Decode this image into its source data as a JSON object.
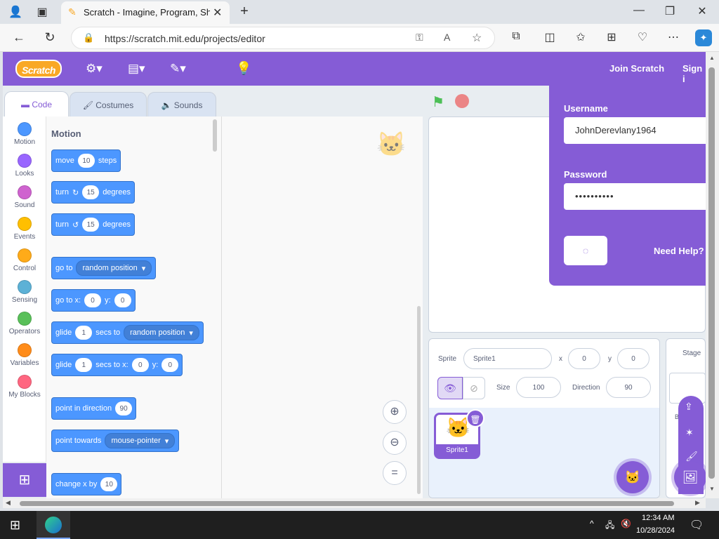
{
  "browser": {
    "tab_title": "Scratch - Imagine, Program, Share",
    "url": "https://scratch.mit.edu/projects/editor"
  },
  "menu": {
    "logo": "Scratch",
    "join": "Join Scratch",
    "signin": "Sign i"
  },
  "tabs": [
    "Code",
    "Costumes",
    "Sounds"
  ],
  "categories": [
    {
      "label": "Motion",
      "color": "#4c97ff"
    },
    {
      "label": "Looks",
      "color": "#9966ff"
    },
    {
      "label": "Sound",
      "color": "#cf63cf"
    },
    {
      "label": "Events",
      "color": "#ffbf00"
    },
    {
      "label": "Control",
      "color": "#ffab19"
    },
    {
      "label": "Sensing",
      "color": "#5cb1d6"
    },
    {
      "label": "Operators",
      "color": "#59c059"
    },
    {
      "label": "Variables",
      "color": "#ff8c1a"
    },
    {
      "label": "My Blocks",
      "color": "#ff6680"
    }
  ],
  "palette": {
    "title": "Motion",
    "b1": {
      "a": "move",
      "n": "10",
      "b": "steps"
    },
    "b2": {
      "a": "turn",
      "n": "15",
      "b": "degrees"
    },
    "b3": {
      "a": "turn",
      "n": "15",
      "b": "degrees"
    },
    "b4": {
      "a": "go to",
      "d": "random position"
    },
    "b5": {
      "a": "go to x:",
      "x": "0",
      "yl": "y:",
      "y": "0"
    },
    "b6": {
      "a": "glide",
      "n": "1",
      "b": "secs to",
      "d": "random position"
    },
    "b7": {
      "a": "glide",
      "n": "1",
      "b": "secs to x:",
      "x": "0",
      "yl": "y:",
      "y": "0"
    },
    "b8": {
      "a": "point in direction",
      "n": "90"
    },
    "b9": {
      "a": "point towards",
      "d": "mouse-pointer"
    },
    "b10": {
      "a": "change x by",
      "n": "10"
    }
  },
  "sprite_info": {
    "sprite_label": "Sprite",
    "sprite_name": "Sprite1",
    "x_label": "x",
    "x": "0",
    "y_label": "y",
    "y": "0",
    "size_label": "Size",
    "size": "100",
    "direction_label": "Direction",
    "direction": "90",
    "tile_name": "Sprite1"
  },
  "stage_pane": {
    "label": "Stage",
    "backdrops": "B"
  },
  "signin": {
    "username_label": "Username",
    "username": "JohnDerevlany1964",
    "password_label": "Password",
    "password": "••••••••••",
    "need_help": "Need Help?"
  },
  "taskbar": {
    "time": "12:34 AM",
    "date": "10/28/2024"
  }
}
